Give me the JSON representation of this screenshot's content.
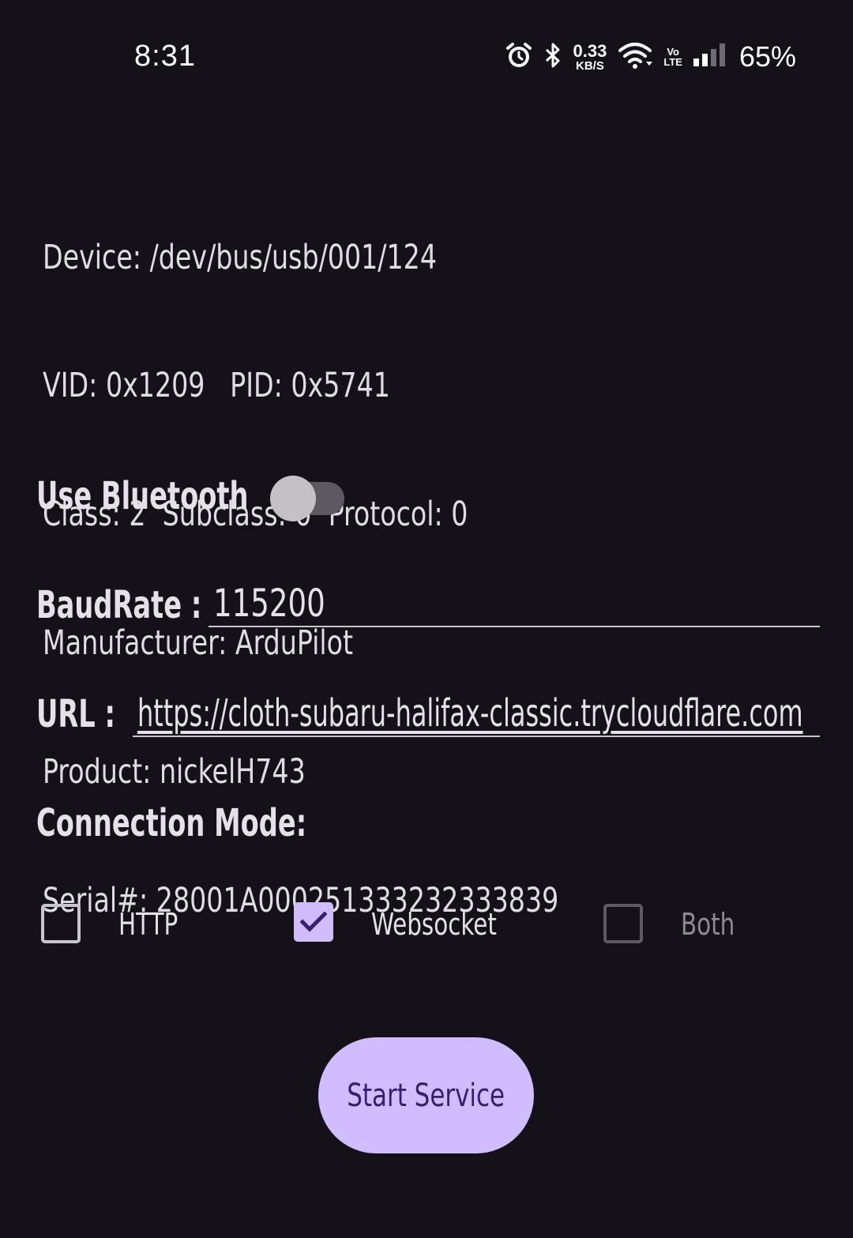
{
  "status_bar": {
    "time": "8:31",
    "net_speed_value": "0.33",
    "net_speed_unit": "KB/S",
    "volte_top": "Vo",
    "volte_bottom": "LTE",
    "battery": "65%",
    "icons": [
      "alarm-icon",
      "bluetooth-icon",
      "wifi-icon",
      "volte-icon",
      "cell-signal-icon"
    ]
  },
  "device_info": {
    "device": "Device: /dev/bus/usb/001/124",
    "ids": "VID: 0x1209   PID: 0x5741",
    "class": "Class: 2  Subclass: 0  Protocol: 0",
    "manufacturer": "Manufacturer: ArduPilot",
    "product": "Product: nickelH743",
    "serial": "Serial#: 28001A000251333232333839"
  },
  "bluetooth": {
    "label": "Use Bluetooth",
    "enabled": false
  },
  "baud_rate": {
    "label": "BaudRate :",
    "value": "115200"
  },
  "url": {
    "label": "URL :",
    "value": "https://cloth-subaru-halifax-classic.trycloudflare.com"
  },
  "connection_mode": {
    "label": "Connection Mode:",
    "options": [
      {
        "label": "HTTP",
        "checked": false,
        "enabled": true
      },
      {
        "label": "Websocket",
        "checked": true,
        "enabled": true
      },
      {
        "label": "Both",
        "checked": false,
        "enabled": false
      }
    ]
  },
  "start_button": {
    "label": "Start Service"
  },
  "colors": {
    "background": "#141218",
    "primary": "#d0bcff",
    "on_primary": "#381e72",
    "text": "#e6e0e9",
    "outline": "#cac4d0",
    "disabled": "#5e5a63"
  }
}
